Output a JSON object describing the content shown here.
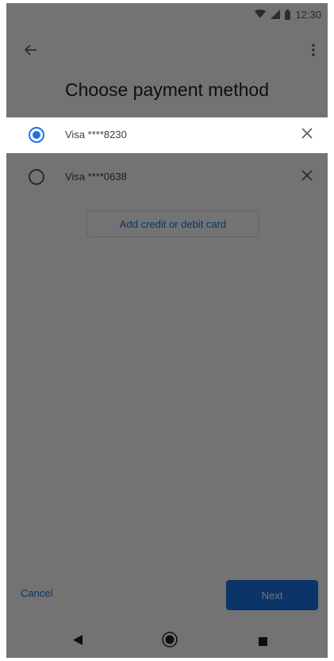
{
  "status_bar": {
    "time": "12:30"
  },
  "header": {
    "title": "Choose payment method"
  },
  "payment_methods": [
    {
      "label": "Visa ****8230",
      "selected": true
    },
    {
      "label": "Visa ****0638",
      "selected": false
    }
  ],
  "add_card_label": "Add credit or debit card",
  "footer": {
    "cancel_label": "Cancel",
    "next_label": "Next"
  },
  "colors": {
    "accent": "#1a73e8",
    "scrim": "rgba(0,0,0,0.55)"
  },
  "icons": {
    "back": "arrow-back-icon",
    "more": "more-vert-icon",
    "remove": "close-icon",
    "nav_back": "nav-back-icon",
    "nav_home": "nav-home-icon",
    "nav_recent": "nav-recent-icon"
  }
}
